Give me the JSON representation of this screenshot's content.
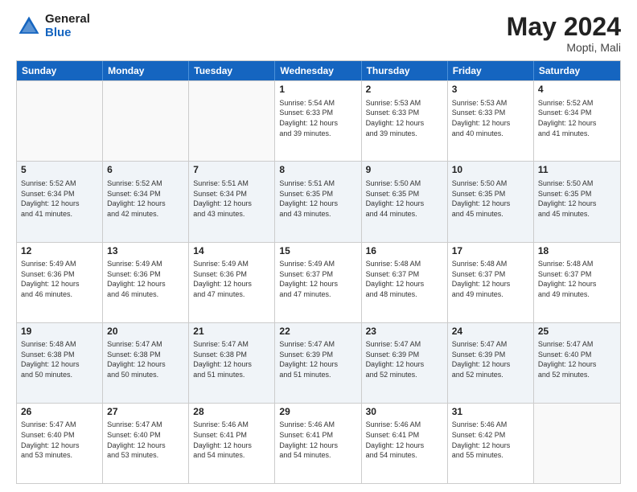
{
  "header": {
    "logo_general": "General",
    "logo_blue": "Blue",
    "title": "May 2024",
    "location": "Mopti, Mali"
  },
  "days_of_week": [
    "Sunday",
    "Monday",
    "Tuesday",
    "Wednesday",
    "Thursday",
    "Friday",
    "Saturday"
  ],
  "weeks": [
    [
      {
        "day": "",
        "info": ""
      },
      {
        "day": "",
        "info": ""
      },
      {
        "day": "",
        "info": ""
      },
      {
        "day": "1",
        "info": "Sunrise: 5:54 AM\nSunset: 6:33 PM\nDaylight: 12 hours\nand 39 minutes."
      },
      {
        "day": "2",
        "info": "Sunrise: 5:53 AM\nSunset: 6:33 PM\nDaylight: 12 hours\nand 39 minutes."
      },
      {
        "day": "3",
        "info": "Sunrise: 5:53 AM\nSunset: 6:33 PM\nDaylight: 12 hours\nand 40 minutes."
      },
      {
        "day": "4",
        "info": "Sunrise: 5:52 AM\nSunset: 6:34 PM\nDaylight: 12 hours\nand 41 minutes."
      }
    ],
    [
      {
        "day": "5",
        "info": "Sunrise: 5:52 AM\nSunset: 6:34 PM\nDaylight: 12 hours\nand 41 minutes."
      },
      {
        "day": "6",
        "info": "Sunrise: 5:52 AM\nSunset: 6:34 PM\nDaylight: 12 hours\nand 42 minutes."
      },
      {
        "day": "7",
        "info": "Sunrise: 5:51 AM\nSunset: 6:34 PM\nDaylight: 12 hours\nand 43 minutes."
      },
      {
        "day": "8",
        "info": "Sunrise: 5:51 AM\nSunset: 6:35 PM\nDaylight: 12 hours\nand 43 minutes."
      },
      {
        "day": "9",
        "info": "Sunrise: 5:50 AM\nSunset: 6:35 PM\nDaylight: 12 hours\nand 44 minutes."
      },
      {
        "day": "10",
        "info": "Sunrise: 5:50 AM\nSunset: 6:35 PM\nDaylight: 12 hours\nand 45 minutes."
      },
      {
        "day": "11",
        "info": "Sunrise: 5:50 AM\nSunset: 6:35 PM\nDaylight: 12 hours\nand 45 minutes."
      }
    ],
    [
      {
        "day": "12",
        "info": "Sunrise: 5:49 AM\nSunset: 6:36 PM\nDaylight: 12 hours\nand 46 minutes."
      },
      {
        "day": "13",
        "info": "Sunrise: 5:49 AM\nSunset: 6:36 PM\nDaylight: 12 hours\nand 46 minutes."
      },
      {
        "day": "14",
        "info": "Sunrise: 5:49 AM\nSunset: 6:36 PM\nDaylight: 12 hours\nand 47 minutes."
      },
      {
        "day": "15",
        "info": "Sunrise: 5:49 AM\nSunset: 6:37 PM\nDaylight: 12 hours\nand 47 minutes."
      },
      {
        "day": "16",
        "info": "Sunrise: 5:48 AM\nSunset: 6:37 PM\nDaylight: 12 hours\nand 48 minutes."
      },
      {
        "day": "17",
        "info": "Sunrise: 5:48 AM\nSunset: 6:37 PM\nDaylight: 12 hours\nand 49 minutes."
      },
      {
        "day": "18",
        "info": "Sunrise: 5:48 AM\nSunset: 6:37 PM\nDaylight: 12 hours\nand 49 minutes."
      }
    ],
    [
      {
        "day": "19",
        "info": "Sunrise: 5:48 AM\nSunset: 6:38 PM\nDaylight: 12 hours\nand 50 minutes."
      },
      {
        "day": "20",
        "info": "Sunrise: 5:47 AM\nSunset: 6:38 PM\nDaylight: 12 hours\nand 50 minutes."
      },
      {
        "day": "21",
        "info": "Sunrise: 5:47 AM\nSunset: 6:38 PM\nDaylight: 12 hours\nand 51 minutes."
      },
      {
        "day": "22",
        "info": "Sunrise: 5:47 AM\nSunset: 6:39 PM\nDaylight: 12 hours\nand 51 minutes."
      },
      {
        "day": "23",
        "info": "Sunrise: 5:47 AM\nSunset: 6:39 PM\nDaylight: 12 hours\nand 52 minutes."
      },
      {
        "day": "24",
        "info": "Sunrise: 5:47 AM\nSunset: 6:39 PM\nDaylight: 12 hours\nand 52 minutes."
      },
      {
        "day": "25",
        "info": "Sunrise: 5:47 AM\nSunset: 6:40 PM\nDaylight: 12 hours\nand 52 minutes."
      }
    ],
    [
      {
        "day": "26",
        "info": "Sunrise: 5:47 AM\nSunset: 6:40 PM\nDaylight: 12 hours\nand 53 minutes."
      },
      {
        "day": "27",
        "info": "Sunrise: 5:47 AM\nSunset: 6:40 PM\nDaylight: 12 hours\nand 53 minutes."
      },
      {
        "day": "28",
        "info": "Sunrise: 5:46 AM\nSunset: 6:41 PM\nDaylight: 12 hours\nand 54 minutes."
      },
      {
        "day": "29",
        "info": "Sunrise: 5:46 AM\nSunset: 6:41 PM\nDaylight: 12 hours\nand 54 minutes."
      },
      {
        "day": "30",
        "info": "Sunrise: 5:46 AM\nSunset: 6:41 PM\nDaylight: 12 hours\nand 54 minutes."
      },
      {
        "day": "31",
        "info": "Sunrise: 5:46 AM\nSunset: 6:42 PM\nDaylight: 12 hours\nand 55 minutes."
      },
      {
        "day": "",
        "info": ""
      }
    ]
  ]
}
